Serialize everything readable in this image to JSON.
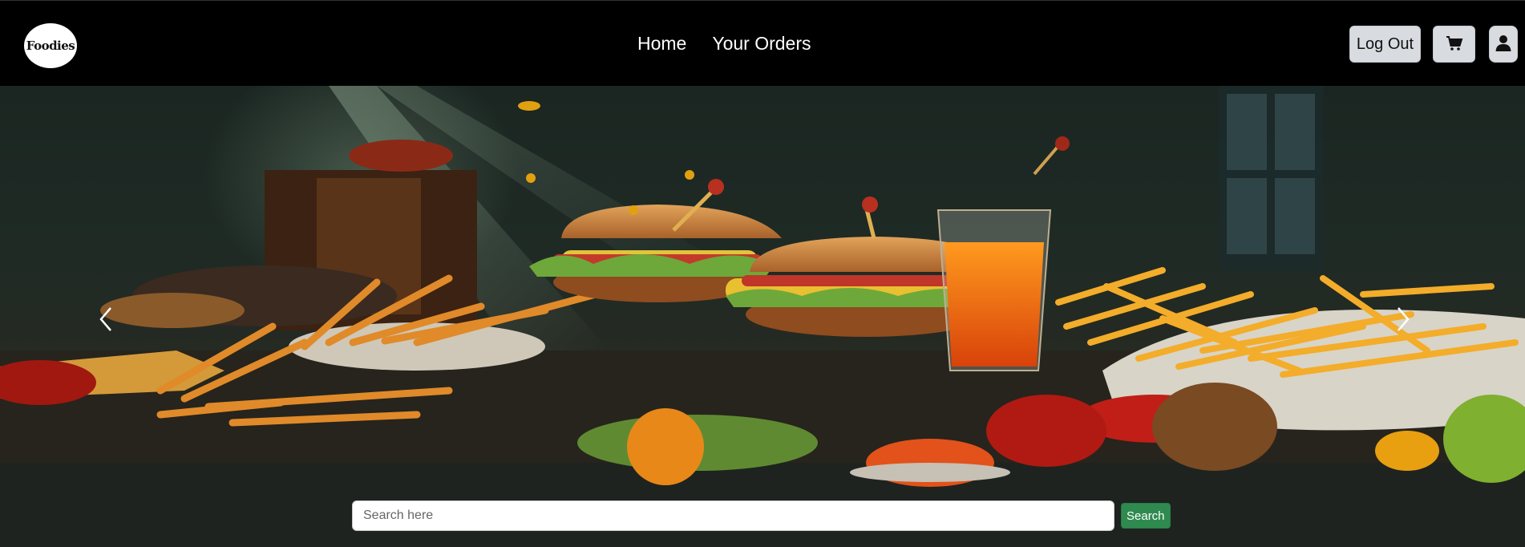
{
  "brand": {
    "logo_text": "Foodies",
    "logo_icon": "foodies-logo"
  },
  "nav": {
    "links": [
      {
        "label": "Home"
      },
      {
        "label": "Your Orders"
      }
    ]
  },
  "header_actions": {
    "logout_label": "Log Out",
    "cart_icon": "cart-icon",
    "profile_icon": "user-icon"
  },
  "hero": {
    "image_alt": "Fast food spread with burgers, fries and juice",
    "prev_icon": "chevron-left-icon",
    "next_icon": "chevron-right-icon"
  },
  "search": {
    "placeholder": "Search here",
    "value": "",
    "button_label": "Search"
  },
  "colors": {
    "navbar_bg": "#000000",
    "button_light": "#d8dbe0",
    "search_button": "#2f8a4f"
  }
}
